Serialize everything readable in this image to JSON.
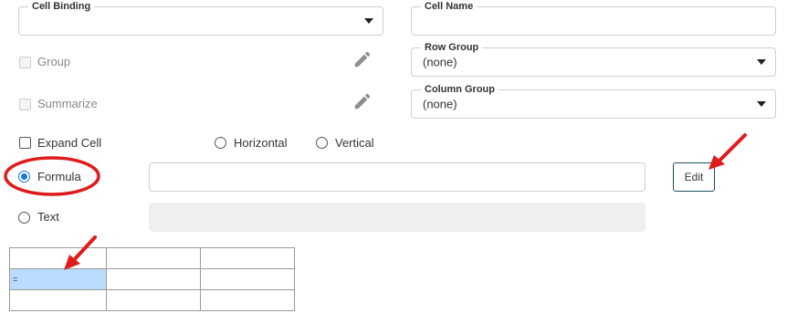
{
  "cell_binding": {
    "legend": "Cell Binding",
    "value": ""
  },
  "cell_name": {
    "legend": "Cell Name",
    "value": ""
  },
  "group": {
    "label": "Group"
  },
  "summarize": {
    "label": "Summarize"
  },
  "row_group": {
    "legend": "Row Group",
    "value": "(none)"
  },
  "column_group": {
    "legend": "Column Group",
    "value": "(none)"
  },
  "expand_cell": {
    "label": "Expand Cell"
  },
  "orientation": {
    "horizontal": "Horizontal",
    "vertical": "Vertical"
  },
  "formula": {
    "label": "Formula",
    "value": ""
  },
  "edit_button": {
    "label": "Edit"
  },
  "text": {
    "label": "Text",
    "value": ""
  },
  "preview_grid": {
    "rows": [
      [
        "",
        "",
        ""
      ],
      [
        "=",
        "",
        ""
      ],
      [
        "",
        "",
        ""
      ]
    ]
  },
  "colors": {
    "accent": "#1976d2",
    "annotation": "#e01b1b",
    "selected_cell": "#b9dcff"
  }
}
